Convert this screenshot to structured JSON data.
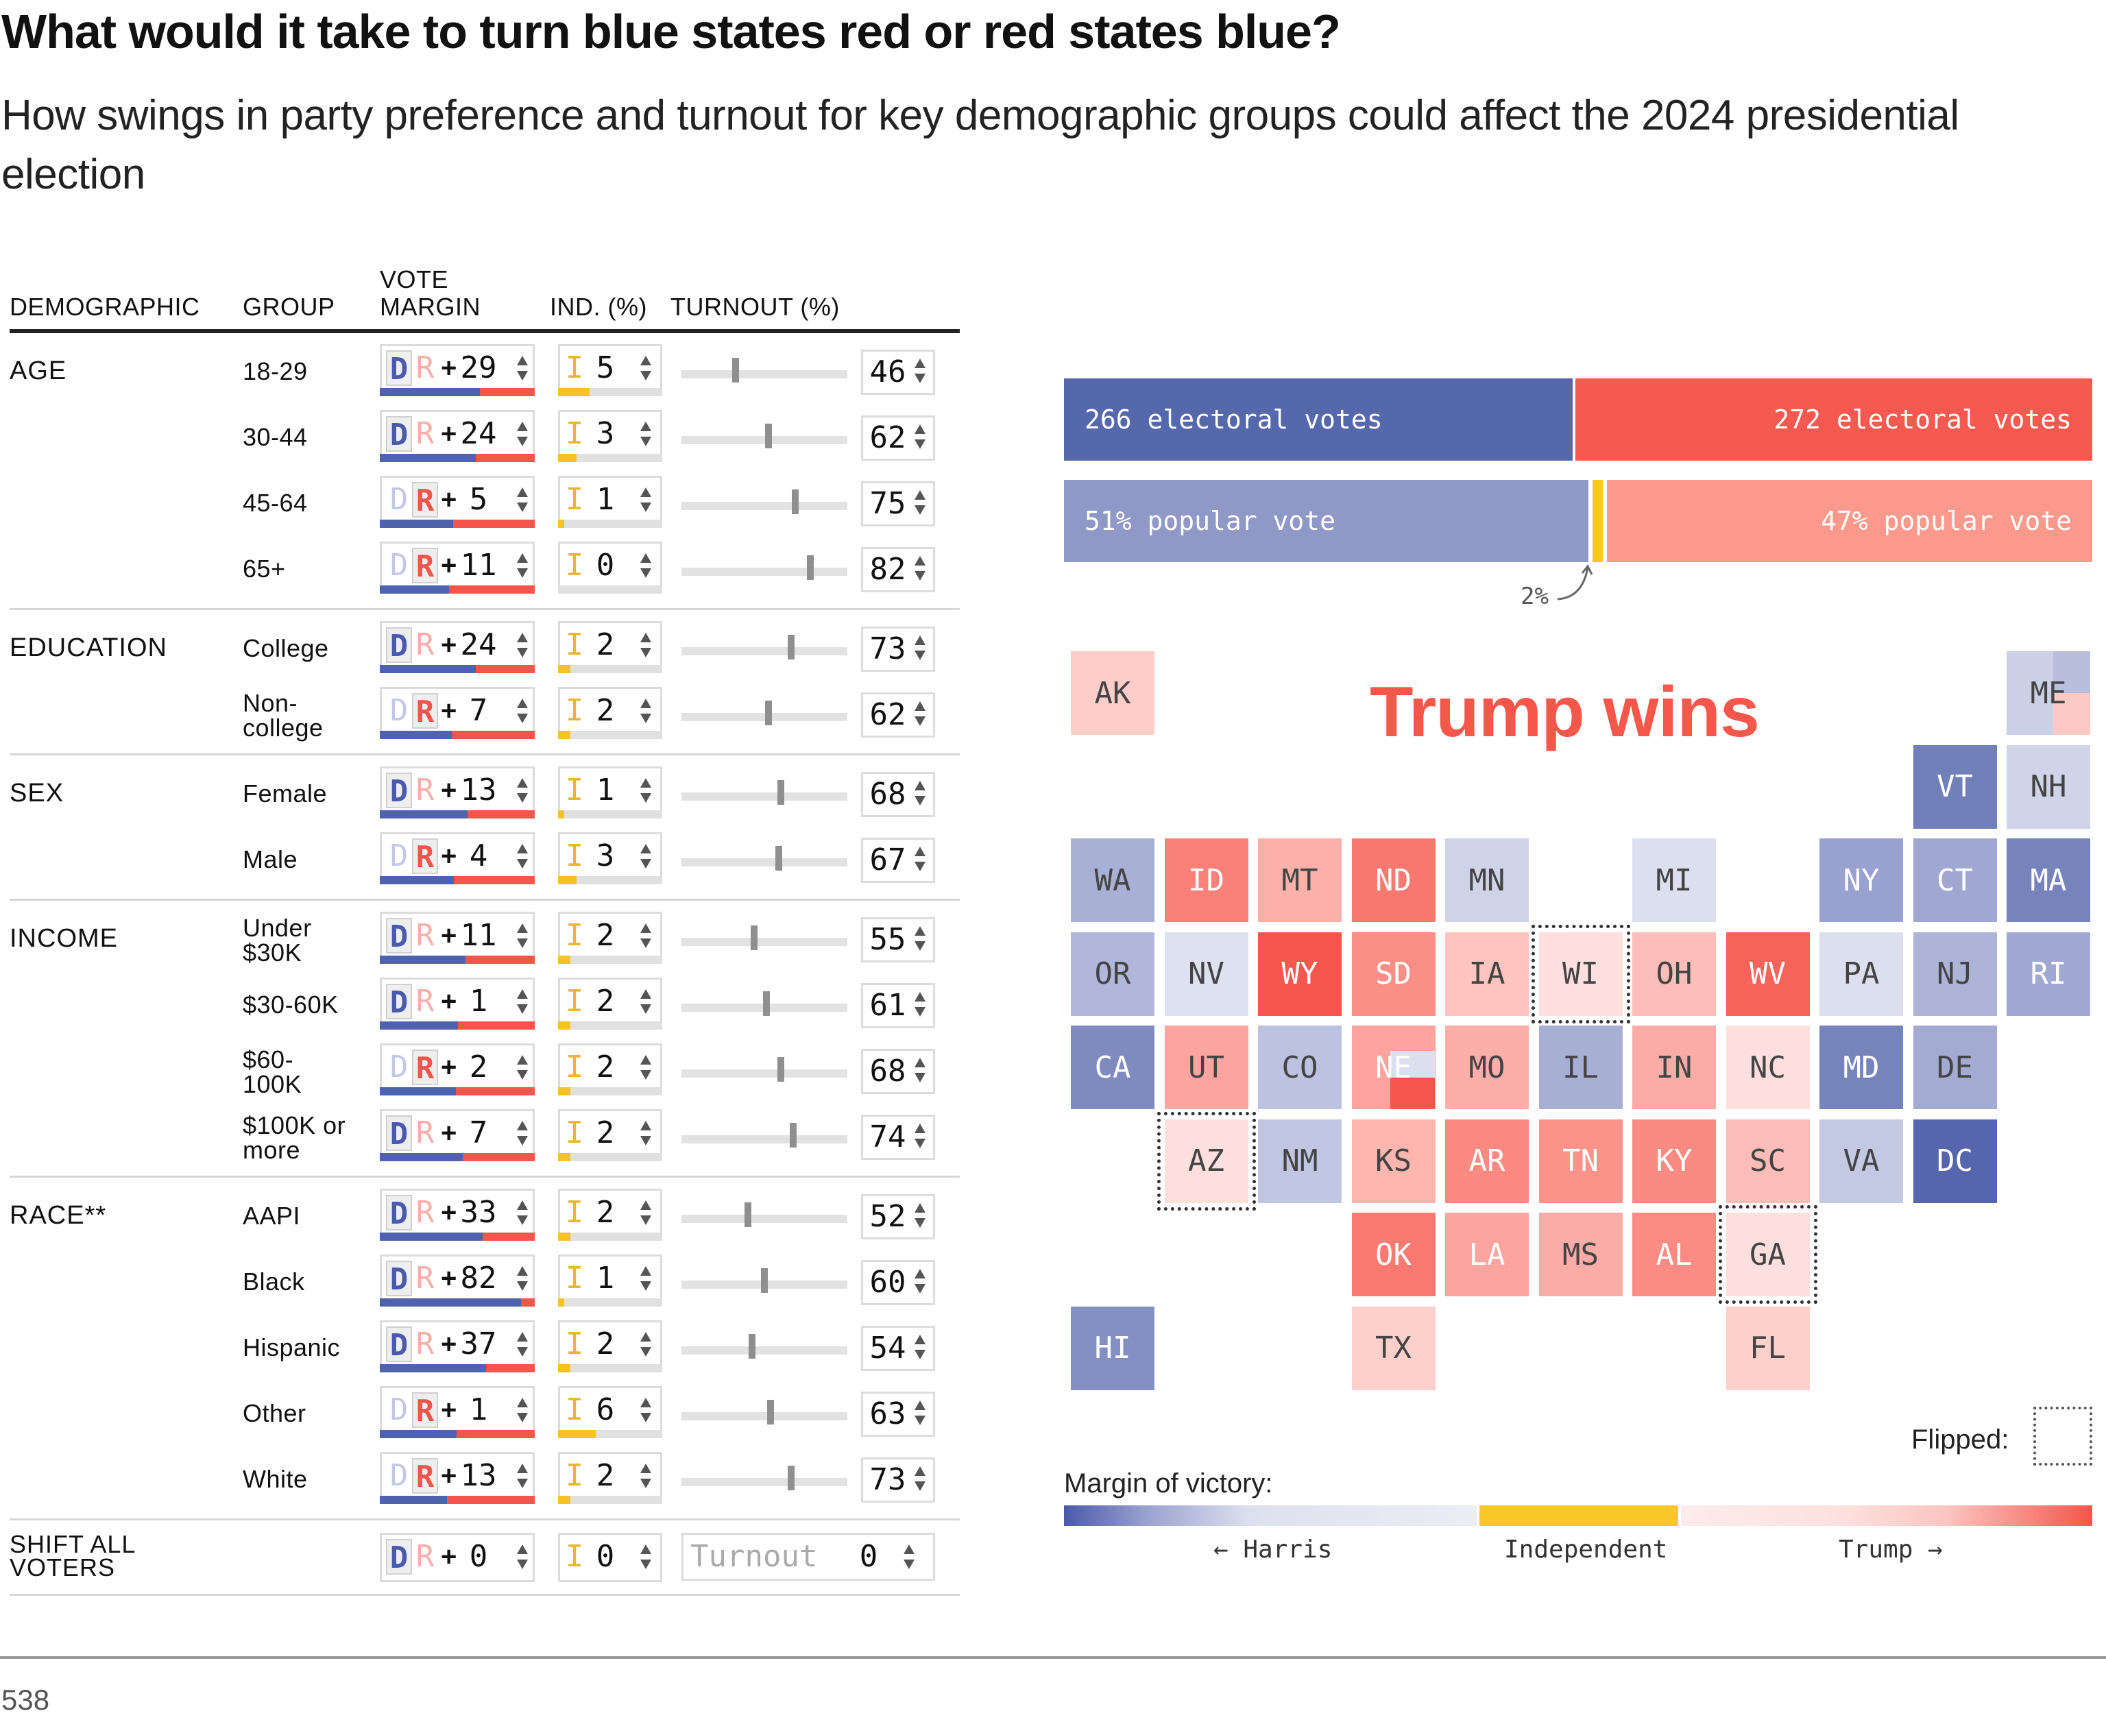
{
  "header": {
    "title": "What would it take to turn blue states red or red states blue?",
    "subtitle": "How swings in party preference and turnout for key demographic groups could affect the 2024 presidential election"
  },
  "table": {
    "columns": {
      "demographic": "DEMOGRAPHIC",
      "group": "GROUP",
      "vote_margin_line1": "VOTE",
      "vote_margin_line2": "MARGIN",
      "ind": "IND. (%)",
      "turnout": "TURNOUT (%)"
    },
    "party_letters": {
      "dem": "D",
      "rep": "R",
      "ind": "I",
      "plus": "+"
    },
    "sections": [
      {
        "label": "AGE",
        "rows": [
          {
            "group": "18-29",
            "party": "D",
            "margin": 29,
            "dem_share": 0.645,
            "ind": 5,
            "turnout": 46
          },
          {
            "group": "30-44",
            "party": "D",
            "margin": 24,
            "dem_share": 0.62,
            "ind": 3,
            "turnout": 62
          },
          {
            "group": "45-64",
            "party": "R",
            "margin": 5,
            "dem_share": 0.475,
            "ind": 1,
            "turnout": 75
          },
          {
            "group": "65+",
            "party": "R",
            "margin": 11,
            "dem_share": 0.445,
            "ind": 0,
            "turnout": 82
          }
        ]
      },
      {
        "label": "EDUCATION",
        "rows": [
          {
            "group": "College",
            "party": "D",
            "margin": 24,
            "dem_share": 0.62,
            "ind": 2,
            "turnout": 73
          },
          {
            "group": "Non-\ncollege",
            "party": "R",
            "margin": 7,
            "dem_share": 0.465,
            "ind": 2,
            "turnout": 62
          }
        ]
      },
      {
        "label": "SEX",
        "rows": [
          {
            "group": "Female",
            "party": "D",
            "margin": 13,
            "dem_share": 0.565,
            "ind": 1,
            "turnout": 68
          },
          {
            "group": "Male",
            "party": "R",
            "margin": 4,
            "dem_share": 0.48,
            "ind": 3,
            "turnout": 67
          }
        ]
      },
      {
        "label": "INCOME",
        "rows": [
          {
            "group": "Under\n$30K",
            "party": "D",
            "margin": 11,
            "dem_share": 0.555,
            "ind": 2,
            "turnout": 55
          },
          {
            "group": "$30-60K",
            "party": "D",
            "margin": 1,
            "dem_share": 0.505,
            "ind": 2,
            "turnout": 61
          },
          {
            "group": "$60-\n100K",
            "party": "R",
            "margin": 2,
            "dem_share": 0.49,
            "ind": 2,
            "turnout": 68
          },
          {
            "group": "$100K or\nmore",
            "party": "D",
            "margin": 7,
            "dem_share": 0.535,
            "ind": 2,
            "turnout": 74
          }
        ]
      },
      {
        "label": "RACE**",
        "rows": [
          {
            "group": "AAPI",
            "party": "D",
            "margin": 33,
            "dem_share": 0.665,
            "ind": 2,
            "turnout": 52
          },
          {
            "group": "Black",
            "party": "D",
            "margin": 82,
            "dem_share": 0.91,
            "ind": 1,
            "turnout": 60
          },
          {
            "group": "Hispanic",
            "party": "D",
            "margin": 37,
            "dem_share": 0.685,
            "ind": 2,
            "turnout": 54
          },
          {
            "group": "Other",
            "party": "R",
            "margin": 1,
            "dem_share": 0.495,
            "ind": 6,
            "turnout": 63
          },
          {
            "group": "White",
            "party": "R",
            "margin": 13,
            "dem_share": 0.435,
            "ind": 2,
            "turnout": 73
          }
        ]
      }
    ],
    "shift_all": {
      "label": "SHIFT ALL\nVOTERS",
      "party": "D",
      "margin": 0,
      "ind": 0,
      "turnout_placeholder": "Turnout",
      "turnout": 0
    }
  },
  "results": {
    "harris_ev_label": "266 electoral votes",
    "trump_ev_label": "272 electoral votes",
    "harris_ev": 266,
    "trump_ev": 272,
    "harris_pv_label": "51% popular vote",
    "trump_pv_label": "47% popular vote",
    "harris_pv": 51,
    "ind_pv": 2,
    "trump_pv": 47,
    "ind_note": "2%",
    "winner": "Trump wins",
    "colors": {
      "harris": "#5668ac",
      "trump": "#f6594f",
      "harris_light": "#9098c8",
      "trump_light": "#fb9a8c",
      "independent": "#f8c820"
    }
  },
  "map": {
    "states": [
      {
        "abbr": "AK",
        "col": 0,
        "row": 0,
        "color": "#fdcdca",
        "text": "dark"
      },
      {
        "abbr": "ME",
        "col": 10,
        "row": 0,
        "color": "#cbd0e6",
        "text": "dark",
        "split": "me"
      },
      {
        "abbr": "VT",
        "col": 9,
        "row": 1,
        "color": "#7180b9",
        "text": "light"
      },
      {
        "abbr": "NH",
        "col": 10,
        "row": 1,
        "color": "#d0d4e8",
        "text": "dark"
      },
      {
        "abbr": "WA",
        "col": 0,
        "row": 2,
        "color": "#a9b0d6",
        "text": "dark"
      },
      {
        "abbr": "ID",
        "col": 1,
        "row": 2,
        "color": "#fa8078",
        "text": "light"
      },
      {
        "abbr": "MT",
        "col": 2,
        "row": 2,
        "color": "#fcb0aa",
        "text": "dark"
      },
      {
        "abbr": "ND",
        "col": 3,
        "row": 2,
        "color": "#fa796f",
        "text": "light"
      },
      {
        "abbr": "MN",
        "col": 4,
        "row": 2,
        "color": "#cfd3e8",
        "text": "dark"
      },
      {
        "abbr": "MI",
        "col": 6,
        "row": 2,
        "color": "#dcdfee",
        "text": "dark"
      },
      {
        "abbr": "NY",
        "col": 8,
        "row": 2,
        "color": "#98a1cf",
        "text": "light"
      },
      {
        "abbr": "CT",
        "col": 9,
        "row": 2,
        "color": "#a0a8d2",
        "text": "light"
      },
      {
        "abbr": "MA",
        "col": 10,
        "row": 2,
        "color": "#7784bb",
        "text": "light"
      },
      {
        "abbr": "OR",
        "col": 0,
        "row": 3,
        "color": "#b1b7da",
        "text": "dark"
      },
      {
        "abbr": "NV",
        "col": 1,
        "row": 3,
        "color": "#dee1ef",
        "text": "dark"
      },
      {
        "abbr": "WY",
        "col": 2,
        "row": 3,
        "color": "#f5574c",
        "text": "light"
      },
      {
        "abbr": "SD",
        "col": 3,
        "row": 3,
        "color": "#fb8f87",
        "text": "light"
      },
      {
        "abbr": "IA",
        "col": 4,
        "row": 3,
        "color": "#fdc4c0",
        "text": "dark"
      },
      {
        "abbr": "WI",
        "col": 5,
        "row": 3,
        "color": "#fde0dd",
        "text": "dark",
        "flipped": true
      },
      {
        "abbr": "OH",
        "col": 6,
        "row": 3,
        "color": "#fdbdb8",
        "text": "dark"
      },
      {
        "abbr": "WV",
        "col": 7,
        "row": 3,
        "color": "#f6635a",
        "text": "light"
      },
      {
        "abbr": "PA",
        "col": 8,
        "row": 3,
        "color": "#dcdfee",
        "text": "dark"
      },
      {
        "abbr": "NJ",
        "col": 9,
        "row": 3,
        "color": "#adb4d8",
        "text": "dark"
      },
      {
        "abbr": "RI",
        "col": 10,
        "row": 3,
        "color": "#a1a9d3",
        "text": "light"
      },
      {
        "abbr": "CA",
        "col": 0,
        "row": 4,
        "color": "#7f8bbf",
        "text": "light"
      },
      {
        "abbr": "UT",
        "col": 1,
        "row": 4,
        "color": "#fca49e",
        "text": "dark"
      },
      {
        "abbr": "CO",
        "col": 2,
        "row": 4,
        "color": "#bcc2df",
        "text": "dark"
      },
      {
        "abbr": "NE",
        "col": 3,
        "row": 4,
        "color": "#fba39c",
        "text": "light",
        "split": "ne"
      },
      {
        "abbr": "MO",
        "col": 4,
        "row": 4,
        "color": "#fcaea8",
        "text": "dark"
      },
      {
        "abbr": "IL",
        "col": 5,
        "row": 4,
        "color": "#a8afd5",
        "text": "dark"
      },
      {
        "abbr": "IN",
        "col": 6,
        "row": 4,
        "color": "#fcaca6",
        "text": "dark"
      },
      {
        "abbr": "NC",
        "col": 7,
        "row": 4,
        "color": "#fde0dd",
        "text": "dark"
      },
      {
        "abbr": "MD",
        "col": 8,
        "row": 4,
        "color": "#7584ba",
        "text": "light"
      },
      {
        "abbr": "DE",
        "col": 9,
        "row": 4,
        "color": "#a3abd3",
        "text": "dark"
      },
      {
        "abbr": "AZ",
        "col": 1,
        "row": 5,
        "color": "#fde0dd",
        "text": "dark",
        "flipped": true
      },
      {
        "abbr": "NM",
        "col": 2,
        "row": 5,
        "color": "#c0c6e1",
        "text": "dark"
      },
      {
        "abbr": "KS",
        "col": 3,
        "row": 5,
        "color": "#fcb5af",
        "text": "dark"
      },
      {
        "abbr": "AR",
        "col": 4,
        "row": 5,
        "color": "#fa8a82",
        "text": "light"
      },
      {
        "abbr": "TN",
        "col": 5,
        "row": 5,
        "color": "#fb938b",
        "text": "light"
      },
      {
        "abbr": "KY",
        "col": 6,
        "row": 5,
        "color": "#fa8b83",
        "text": "light"
      },
      {
        "abbr": "SC",
        "col": 7,
        "row": 5,
        "color": "#fcbcb7",
        "text": "dark"
      },
      {
        "abbr": "VA",
        "col": 8,
        "row": 5,
        "color": "#c4c9e3",
        "text": "dark"
      },
      {
        "abbr": "DC",
        "col": 9,
        "row": 5,
        "color": "#5566ac",
        "text": "light"
      },
      {
        "abbr": "OK",
        "col": 3,
        "row": 6,
        "color": "#f97a70",
        "text": "light"
      },
      {
        "abbr": "LA",
        "col": 4,
        "row": 6,
        "color": "#fca59f",
        "text": "light"
      },
      {
        "abbr": "MS",
        "col": 5,
        "row": 6,
        "color": "#fcaca6",
        "text": "dark"
      },
      {
        "abbr": "AL",
        "col": 6,
        "row": 6,
        "color": "#fa8c84",
        "text": "light"
      },
      {
        "abbr": "GA",
        "col": 7,
        "row": 6,
        "color": "#fde0dd",
        "text": "dark",
        "flipped": true
      },
      {
        "abbr": "HI",
        "col": 0,
        "row": 7,
        "color": "#8490c3",
        "text": "light"
      },
      {
        "abbr": "TX",
        "col": 3,
        "row": 7,
        "color": "#fdd0cc",
        "text": "dark"
      },
      {
        "abbr": "FL",
        "col": 7,
        "row": 7,
        "color": "#fdd0cc",
        "text": "dark"
      }
    ]
  },
  "legend": {
    "flipped_label": "Flipped:",
    "margin_label": "Margin of victory:",
    "harris_label": "← Harris",
    "independent_label": "Independent",
    "trump_label": "Trump →"
  },
  "footer": {
    "source": "538"
  }
}
